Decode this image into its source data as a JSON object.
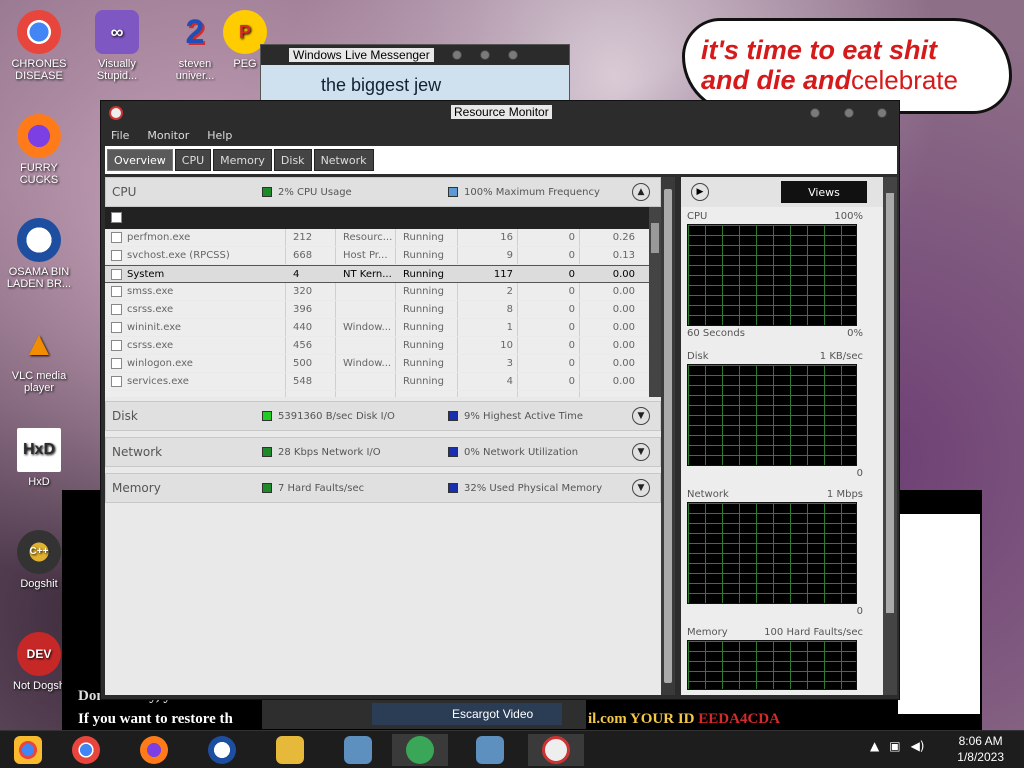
{
  "desktop": {
    "icons": [
      {
        "label": "CHRONES DISEASE",
        "color": "#e8453c",
        "glyph": "●"
      },
      {
        "label": "Visually Stupid...",
        "color": "#7e57c2",
        "glyph": "∞"
      },
      {
        "label": "steven univer...",
        "color": "#1f4fb6",
        "glyph": "2"
      },
      {
        "label": "PEG",
        "color": "#d02c2c",
        "glyph": "P"
      },
      {
        "label": "FURRY CUCKS",
        "color": "#ff7b1a",
        "glyph": "🦊"
      },
      {
        "label": "OSAMA BIN LADEN BR...",
        "color": "#1d4ea0",
        "glyph": "O"
      },
      {
        "label": "VLC media player",
        "color": "#f28c00",
        "glyph": "▲"
      },
      {
        "label": "HxD",
        "color": "#2b2b2b",
        "glyph": "HxD"
      },
      {
        "label": "Dogshit",
        "color": "#333333",
        "glyph": "C++"
      },
      {
        "label": "Not Dogsh",
        "color": "#c62828",
        "glyph": "DEV"
      }
    ]
  },
  "messenger": {
    "title": "Windows Live Messenger",
    "status": "the biggest jew"
  },
  "bubble": {
    "line1": "it's time to eat shit",
    "line2": "and die and",
    "line2b": "celebrate"
  },
  "ransom": {
    "line1": "Don't worry, you can re",
    "line2": "If you want to restore th",
    "line3": "il.com YOUR ID",
    "id": "EEDA4CDA"
  },
  "media": {
    "label": "Escargot Video"
  },
  "resource_monitor": {
    "title": "Resource Monitor",
    "menu": [
      "File",
      "Monitor",
      "Help"
    ],
    "tabs": [
      "Overview",
      "CPU",
      "Memory",
      "Disk",
      "Network"
    ],
    "cpu": {
      "name": "CPU",
      "metric1": "2% CPU Usage",
      "metric1_color": "#1f8a2a",
      "metric2": "100% Maximum Frequency",
      "metric2_color": "#5b9bd5",
      "rows": [
        {
          "image": "perfmon.exe",
          "pid": "212",
          "desc": "Resourc...",
          "status": "Running",
          "threads": "16",
          "cpu": "0",
          "avg": "0.26"
        },
        {
          "image": "svchost.exe (RPCSS)",
          "pid": "668",
          "desc": "Host Pr...",
          "status": "Running",
          "threads": "9",
          "cpu": "0",
          "avg": "0.13"
        },
        {
          "image": "System",
          "pid": "4",
          "desc": "NT Kern...",
          "status": "Running",
          "threads": "117",
          "cpu": "0",
          "avg": "0.00"
        },
        {
          "image": "smss.exe",
          "pid": "320",
          "desc": "",
          "status": "Running",
          "threads": "2",
          "cpu": "0",
          "avg": "0.00"
        },
        {
          "image": "csrss.exe",
          "pid": "396",
          "desc": "",
          "status": "Running",
          "threads": "8",
          "cpu": "0",
          "avg": "0.00"
        },
        {
          "image": "wininit.exe",
          "pid": "440",
          "desc": "Window...",
          "status": "Running",
          "threads": "1",
          "cpu": "0",
          "avg": "0.00"
        },
        {
          "image": "csrss.exe",
          "pid": "456",
          "desc": "",
          "status": "Running",
          "threads": "10",
          "cpu": "0",
          "avg": "0.00"
        },
        {
          "image": "winlogon.exe",
          "pid": "500",
          "desc": "Window...",
          "status": "Running",
          "threads": "3",
          "cpu": "0",
          "avg": "0.00"
        },
        {
          "image": "services.exe",
          "pid": "548",
          "desc": "",
          "status": "Running",
          "threads": "4",
          "cpu": "0",
          "avg": "0.00"
        }
      ]
    },
    "disk": {
      "name": "Disk",
      "metric1": "5391360 B/sec Disk I/O",
      "metric1_color": "#22cc22",
      "metric2": "9% Highest Active Time",
      "metric2_color": "#1a2fb0"
    },
    "network": {
      "name": "Network",
      "metric1": "28 Kbps Network I/O",
      "metric1_color": "#1f8a2a",
      "metric2": "0% Network Utilization",
      "metric2_color": "#1a2fb0"
    },
    "memory": {
      "name": "Memory",
      "metric1": "7 Hard Faults/sec",
      "metric1_color": "#1f8a2a",
      "metric2": "32% Used Physical Memory",
      "metric2_color": "#1a2fb0"
    },
    "graphs": {
      "views_label": "Views",
      "cpu": {
        "label": "CPU",
        "max": "100%",
        "footer_left": "60 Seconds",
        "footer_right": "0%"
      },
      "disk": {
        "label": "Disk",
        "max": "1 KB/sec",
        "footer_right": "0"
      },
      "network": {
        "label": "Network",
        "max": "1 Mbps",
        "footer_right": "0"
      },
      "memory": {
        "label": "Memory",
        "max": "100 Hard Faults/sec"
      }
    }
  },
  "taskbar": {
    "time": "8:06 AM",
    "date": "1/8/2023"
  }
}
